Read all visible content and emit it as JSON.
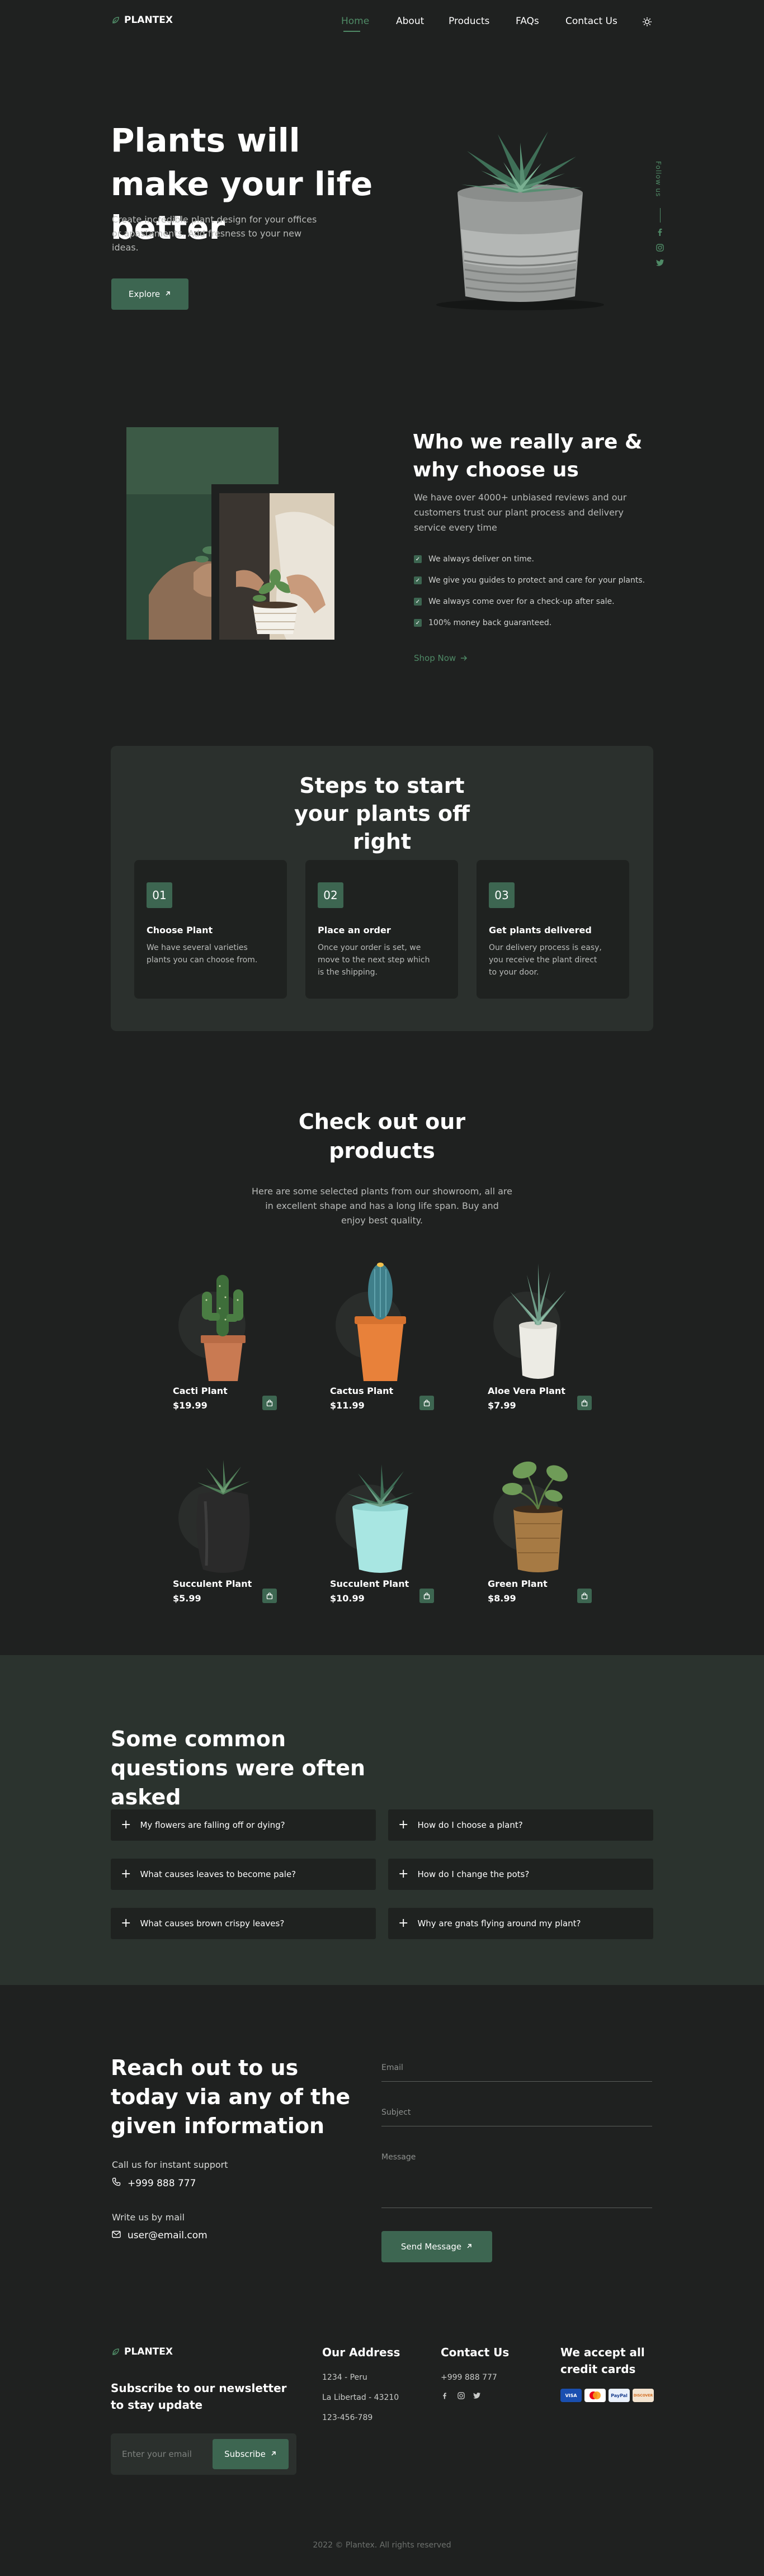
{
  "brand": {
    "name": "PLANTEX",
    "accent": "#3d6651",
    "accent_light": "#4f8a66",
    "background": "#1f2120"
  },
  "nav": {
    "items": [
      "Home",
      "About",
      "Products",
      "FAQs",
      "Contact Us"
    ],
    "theme_toggle_icon": "sun-icon"
  },
  "hero": {
    "title": "Plants will make your life better",
    "subtitle": "Create incredible plant design for your offices or apastaments. Add fresness to your new ideas.",
    "button": "Explore",
    "follow_label": "Follow us",
    "social_icons": [
      "facebook-icon",
      "instagram-icon",
      "twitter-icon"
    ]
  },
  "about": {
    "title": "Who we really are & why choose us",
    "text": "We have over 4000+ unbiased reviews and our customers trust our plant process and delivery service every time",
    "points": [
      "We always deliver on time.",
      "We give you guides to protect and care for your plants.",
      "We always come over for a check-up after sale.",
      "100% money back guaranteed."
    ],
    "link": "Shop Now"
  },
  "steps": {
    "title": "Steps to start your plants off right",
    "items": [
      {
        "num": "01",
        "title": "Choose Plant",
        "desc": "We have several varieties plants you can choose from."
      },
      {
        "num": "02",
        "title": "Place an order",
        "desc": "Once your order is set, we move to the next step which is the shipping."
      },
      {
        "num": "03",
        "title": "Get plants delivered",
        "desc": "Our delivery process is easy, you receive the plant direct to your door."
      }
    ]
  },
  "products": {
    "title": "Check out our products",
    "subtitle": "Here are some selected plants from our showroom, all are in excellent shape and has a long life span. Buy and enjoy best quality.",
    "items": [
      {
        "name": "Cacti Plant",
        "price": "$19.99",
        "pot": "#c97a52"
      },
      {
        "name": "Cactus Plant",
        "price": "$11.99",
        "pot": "#e8813a"
      },
      {
        "name": "Aloe Vera Plant",
        "price": "$7.99",
        "pot": "#ecebe4"
      },
      {
        "name": "Succulent Plant",
        "price": "$5.99",
        "pot": "#2a2a2a"
      },
      {
        "name": "Succulent Plant",
        "price": "$10.99",
        "pot": "#a8e6e2"
      },
      {
        "name": "Green Plant",
        "price": "$8.99",
        "pot": "#a67a44"
      }
    ]
  },
  "faq": {
    "title": "Some common questions were often asked",
    "items": [
      "My flowers are falling off or dying?",
      "How do I choose a plant?",
      "What causes leaves to become pale?",
      "How do I change the pots?",
      "What causes brown crispy leaves?",
      "Why are gnats flying around my plant?"
    ]
  },
  "contact": {
    "title": "Reach out to us today via any of the given information",
    "call_label": "Call us for instant support",
    "phone": "+999 888 777",
    "mail_label": "Write us by mail",
    "email": "user@email.com",
    "fields": [
      "Email",
      "Subject",
      "Message"
    ],
    "button": "Send Message"
  },
  "footer": {
    "newsletter_title": "Subscribe to our newsletter to stay update",
    "newsletter_placeholder": "Enter your email",
    "subscribe": "Subscribe",
    "address_title": "Our Address",
    "address_lines": [
      "1234 - Peru",
      "La Libertad - 43210",
      "123-456-789"
    ],
    "contact_title": "Contact Us",
    "contact_phone": "+999 888 777",
    "cards_title": "We accept all credit cards",
    "cards": [
      "VISA",
      "MC",
      "PayPal",
      "DISCOVER"
    ],
    "copyright": "2022 © Plantex. All rights reserved"
  }
}
